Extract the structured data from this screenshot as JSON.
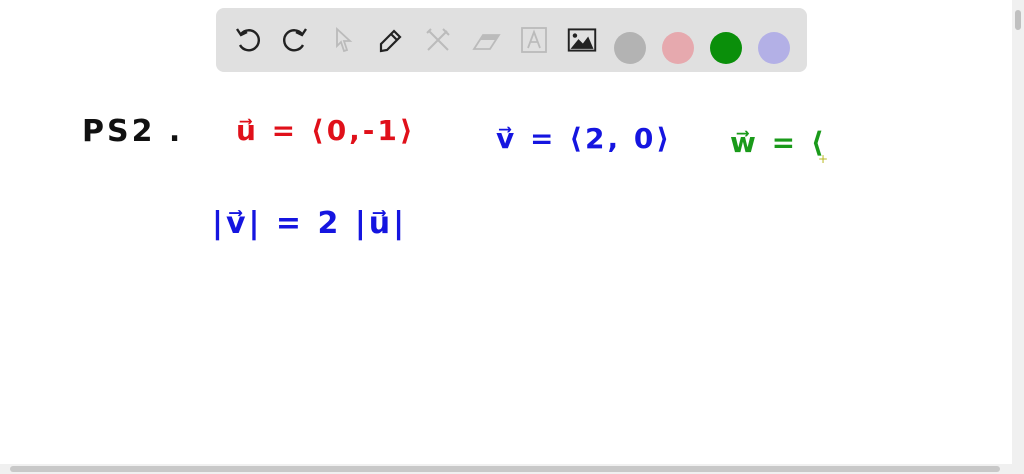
{
  "toolbar": {
    "tools": [
      "undo-icon",
      "redo-icon",
      "select-icon",
      "pen-icon",
      "tools-icon",
      "eraser-icon",
      "text-icon",
      "image-icon"
    ],
    "colors": [
      "#b3b3b3",
      "#e6a9ae",
      "#0a8f0a",
      "#b3b0e6"
    ]
  },
  "canvas": {
    "problem_label": "PS2 .",
    "u_eq": "u⃗ = ⟨0,-1⟩",
    "v_eq": "v⃗ = ⟨2, 0⟩",
    "w_eq": "w⃗ = ⟨",
    "magnitude_eq": "|v⃗| = 2 |u⃗|",
    "ink_colors": {
      "black": "#111111",
      "red": "#e0101a",
      "blue": "#1515e0",
      "green": "#1a9a1a"
    }
  }
}
